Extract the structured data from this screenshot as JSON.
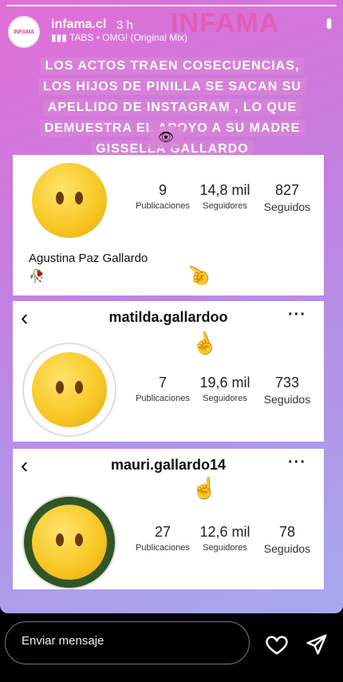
{
  "header": {
    "username": "infama.cl",
    "time": "3 h",
    "music": "TABS • OMG! (Original Mix)",
    "avatar_text": "INFAMA",
    "watermark": "INFAMA"
  },
  "headline": "LOS ACTOS TRAEN COSECUENCIAS, LOS HIJOS DE PINILLA SE SACAN SU APELLIDO DE INSTAGRAM , LO QUE DEMUESTRA EL APOYO A SU MADRE GISSELLA GALLARDO",
  "profiles": [
    {
      "name": "Agustina Paz Gallardo",
      "posts": "9",
      "posts_label": "Publicaciones",
      "followers": "14,8 mil",
      "followers_label": "Seguidores",
      "following": "827",
      "following_label": "Seguidos"
    },
    {
      "handle": "matilda.gallardoo",
      "posts": "7",
      "posts_label": "Publicaciones",
      "followers": "19,6 mil",
      "followers_label": "Seguidores",
      "following": "733",
      "following_label": "Seguidos"
    },
    {
      "handle": "mauri.gallardo14",
      "posts": "27",
      "posts_label": "Publicaciones",
      "followers": "12,6 mil",
      "followers_label": "Seguidores",
      "following": "78",
      "following_label": "Seguidos"
    }
  ],
  "footer": {
    "message_placeholder": "Enviar mensaje",
    "like_icon": "heart-icon",
    "share_icon": "send-icon"
  },
  "colors": {
    "gradient_start": "#e16fd6",
    "gradient_end": "#a7a8ef",
    "watermark": "#ec4899",
    "emoji": "#f8c927"
  }
}
